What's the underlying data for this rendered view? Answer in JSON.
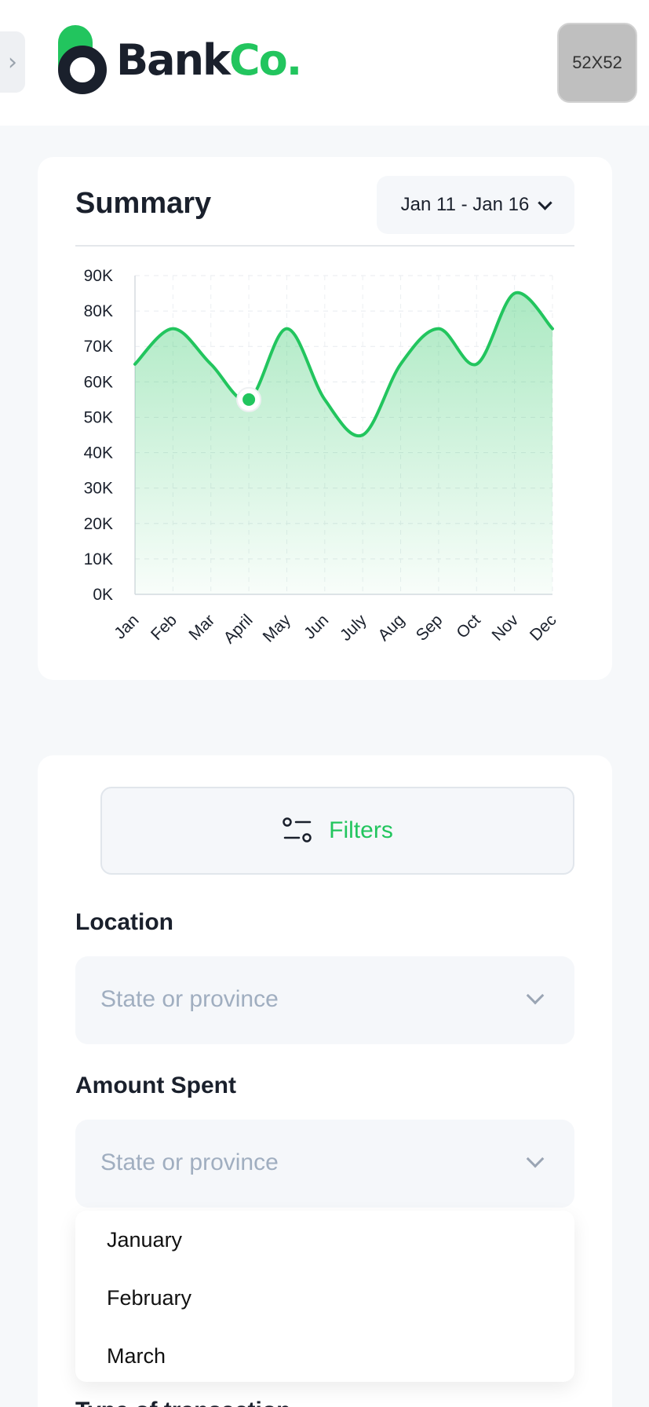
{
  "header": {
    "logo_text_a": "Bank",
    "logo_text_b": "Co.",
    "avatar_text": "52X52",
    "side_toggle_icon": "chevron-right-icon"
  },
  "summary": {
    "title": "Summary",
    "date_range": "Jan 11 - Jan 16",
    "date_icon": "chevron-down-icon"
  },
  "chart_data": {
    "type": "area",
    "title": "",
    "xlabel": "",
    "ylabel": "",
    "categories": [
      "Jan",
      "Feb",
      "Mar",
      "April",
      "May",
      "Jun",
      "July",
      "Aug",
      "Sep",
      "Oct",
      "Nov",
      "Dec"
    ],
    "y_ticks": [
      "0K",
      "10K",
      "20K",
      "30K",
      "40K",
      "50K",
      "60K",
      "70K",
      "80K",
      "90K"
    ],
    "ylim": [
      0,
      90000
    ],
    "grid": true,
    "series": [
      {
        "values": [
          65000,
          75000,
          65000,
          55000,
          75000,
          55000,
          45000,
          65000,
          75000,
          65000,
          85000,
          75000
        ]
      }
    ],
    "highlight_index": 3,
    "line_color": "#22c55e",
    "fill_color": "#22c55e"
  },
  "filters": {
    "button_label": "Filters",
    "button_icon": "sliders-icon",
    "location_label": "Location",
    "location_placeholder": "State or province",
    "amount_label": "Amount Spent",
    "amount_placeholder": "State or province",
    "dropdown_options": [
      "January",
      "February",
      "March"
    ],
    "next_label": "Type of transaction"
  },
  "colors": {
    "accent": "#22c55e",
    "text": "#1a202c",
    "placeholder": "#a0aec0",
    "field_bg": "#f5f7fa"
  }
}
